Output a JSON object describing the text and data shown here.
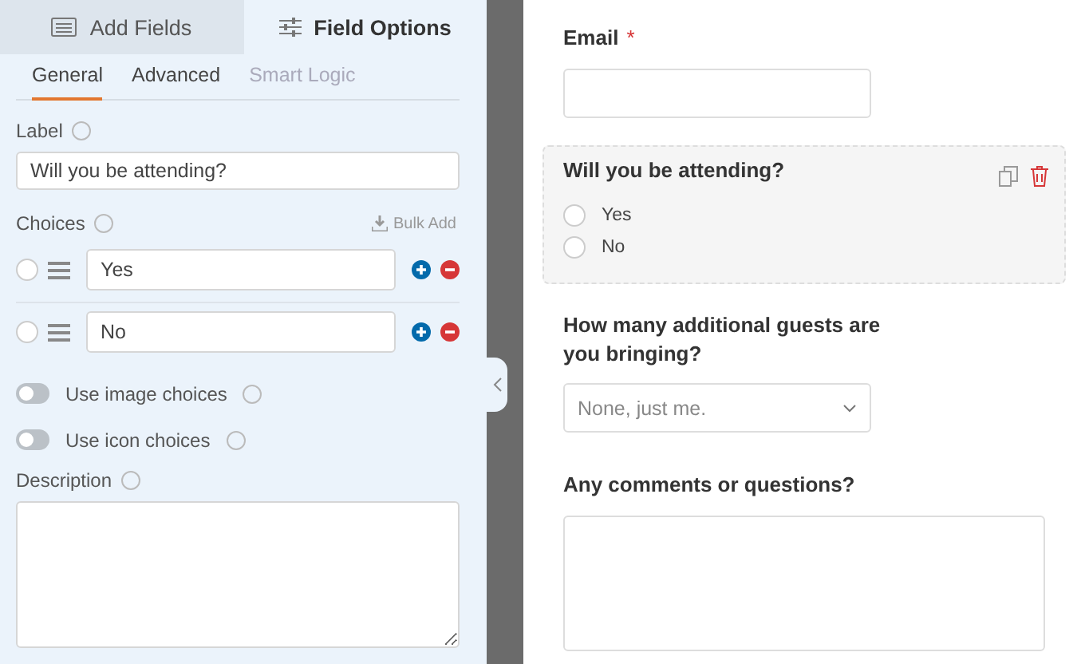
{
  "panel_tabs": [
    {
      "label": "Add Fields",
      "kind": "list",
      "selected": false
    },
    {
      "label": "Field Options",
      "kind": "sliders",
      "selected": true
    }
  ],
  "sub_tabs": [
    {
      "label": "General",
      "selected": true,
      "disabled": false
    },
    {
      "label": "Advanced",
      "selected": false,
      "disabled": false
    },
    {
      "label": "Smart Logic",
      "selected": false,
      "disabled": true
    }
  ],
  "label_field": {
    "label": "Label",
    "value": "Will you be attending?"
  },
  "choices": {
    "label": "Choices",
    "bulk_add": "Bulk Add",
    "items": [
      {
        "value": "Yes",
        "selected": false
      },
      {
        "value": "No",
        "selected": false
      }
    ]
  },
  "toggles": [
    {
      "label": "Use image choices",
      "on": false
    },
    {
      "label": "Use icon choices",
      "on": false
    }
  ],
  "description": {
    "label": "Description"
  },
  "preview": {
    "fields": [
      {
        "kind": "text",
        "label": "Email",
        "required": true,
        "selected": false
      },
      {
        "kind": "radio",
        "label": "Will you be attending?",
        "required": false,
        "selected": true,
        "options": [
          "Yes",
          "No"
        ]
      },
      {
        "kind": "select",
        "label": "How many additional guests are you bringing?",
        "required": false,
        "selected": false,
        "placeholder": "None, just me."
      },
      {
        "kind": "textarea",
        "label": "Any comments or questions?",
        "required": false,
        "selected": false
      }
    ],
    "required_mark": "*"
  }
}
